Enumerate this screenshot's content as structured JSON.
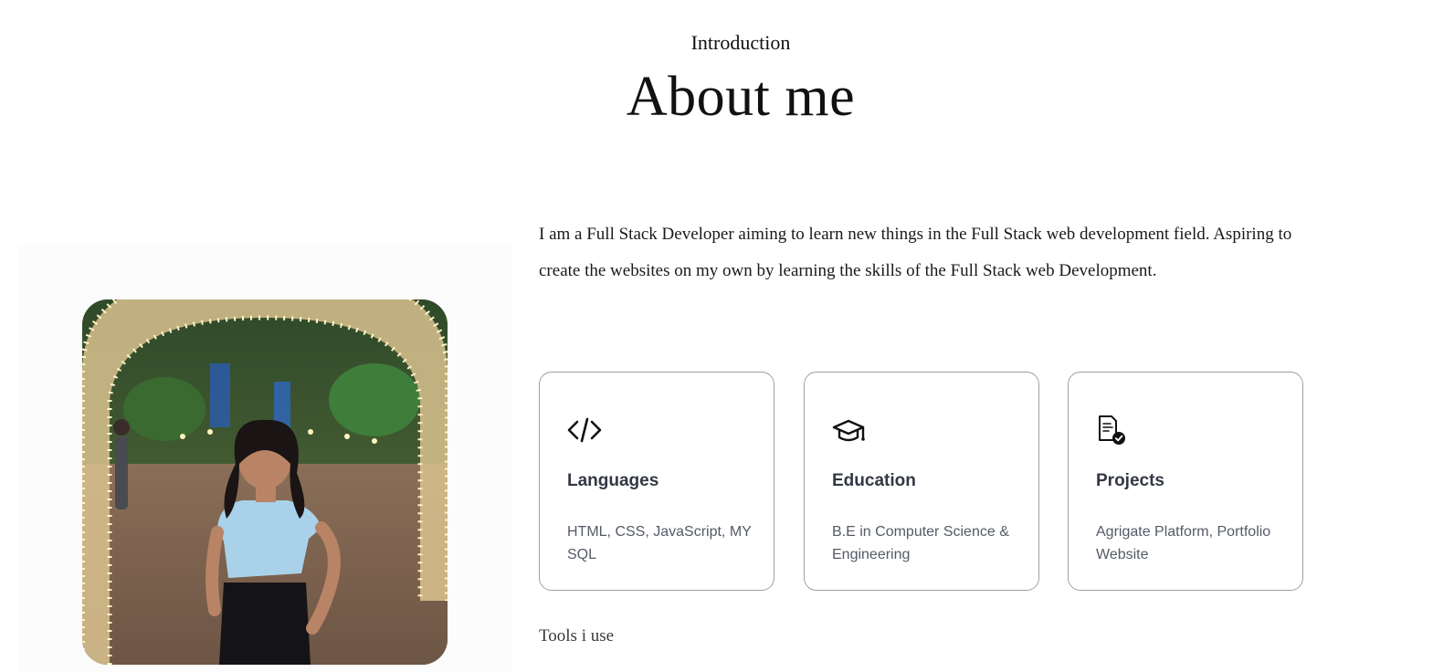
{
  "header": {
    "eyebrow": "Introduction",
    "title": "About me"
  },
  "profile": {
    "photo_alt": "Profile photo"
  },
  "about": {
    "text": "I am a Full Stack Developer aiming to learn new things in the Full Stack web development field. Aspiring to create the websites on my own by learning the skills of the Full Stack web Development."
  },
  "cards": [
    {
      "icon": "code-icon",
      "title": "Languages",
      "desc": "HTML, CSS, JavaScript, MY SQL"
    },
    {
      "icon": "graduation-cap-icon",
      "title": "Education",
      "desc": "B.E in Computer Science & Engineering"
    },
    {
      "icon": "project-document-icon",
      "title": "Projects",
      "desc": "Agrigate Platform, Portfolio Website"
    }
  ],
  "tools": {
    "label": "Tools i use"
  },
  "colors": {
    "card_border": "#9aa0aa",
    "card_title": "#333844",
    "card_desc": "#555a66",
    "photo_panel": "#fcfcfc"
  }
}
